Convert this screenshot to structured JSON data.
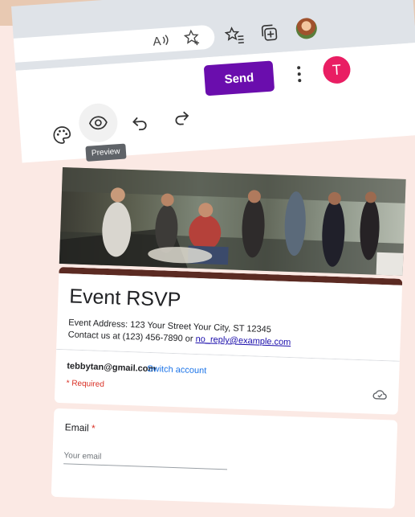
{
  "browser": {
    "icons": [
      "read-aloud-icon",
      "favorite-add-icon",
      "favorites-icon",
      "collections-icon",
      "profile-photo"
    ]
  },
  "toolbar": {
    "send_label": "Send",
    "avatar_letter": "T",
    "preview_tooltip": "Preview",
    "icons": [
      "palette-icon",
      "eye-icon",
      "undo-icon",
      "redo-icon",
      "more-vert-icon"
    ]
  },
  "form": {
    "title": "Event RSVP",
    "address_line": "Event Address: 123 Your Street Your City, ST 12345",
    "contact_prefix": "Contact us at (123) 456-7890 or ",
    "contact_email": "no_reply@example.com",
    "account_email": "tebbytan@gmail.com",
    "switch_account": "Switch account",
    "required_note": "* Required",
    "question": {
      "label": "Email",
      "required_mark": " *",
      "placeholder": "Your email"
    }
  },
  "colors": {
    "accent": "#6a0dad",
    "avatar": "#e91e63",
    "theme_bar": "#5b2a22",
    "link": "#1a73e8",
    "required": "#d93025"
  }
}
